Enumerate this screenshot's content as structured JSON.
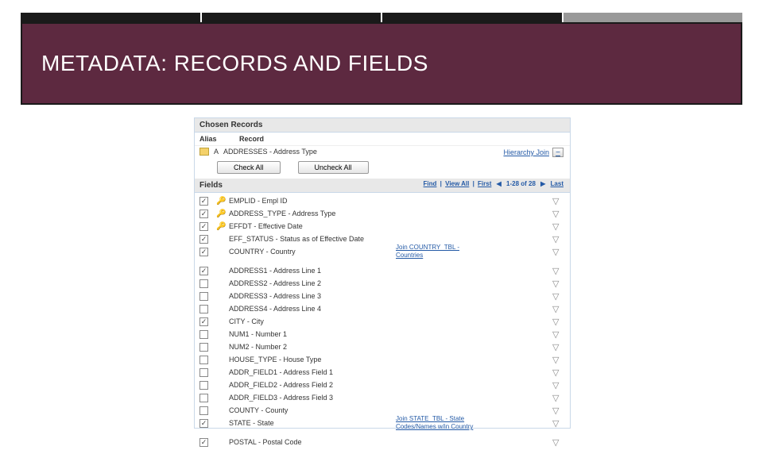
{
  "slide_title": "METADATA: RECORDS AND FIELDS",
  "panel": {
    "chosen_records": "Chosen Records",
    "alias_hdr": "Alias",
    "record_hdr": "Record",
    "alias_value": "A",
    "record_value": "ADDRESSES - Address Type",
    "check_all": "Check All",
    "uncheck_all": "Uncheck All",
    "hierarchy_join": "Hierarchy Join",
    "fields_hdr": "Fields",
    "pager": {
      "find": "Find",
      "viewall": "View All",
      "first": "First",
      "range": "1-28 of 28",
      "last": "Last"
    }
  },
  "fields": [
    {
      "checked": true,
      "key": true,
      "label": "EMPLID - Empl ID",
      "join": ""
    },
    {
      "checked": true,
      "key": true,
      "label": "ADDRESS_TYPE - Address Type",
      "join": ""
    },
    {
      "checked": true,
      "key": true,
      "label": "EFFDT - Effective Date",
      "join": ""
    },
    {
      "checked": true,
      "key": false,
      "label": "EFF_STATUS - Status as of Effective Date",
      "join": ""
    },
    {
      "checked": true,
      "key": false,
      "label": "COUNTRY - Country",
      "join": "Join COUNTRY_TBL - Countries"
    },
    {
      "checked": true,
      "key": false,
      "label": "ADDRESS1 - Address Line 1",
      "join": ""
    },
    {
      "checked": false,
      "key": false,
      "label": "ADDRESS2 - Address Line 2",
      "join": ""
    },
    {
      "checked": false,
      "key": false,
      "label": "ADDRESS3 - Address Line 3",
      "join": ""
    },
    {
      "checked": false,
      "key": false,
      "label": "ADDRESS4 - Address Line 4",
      "join": ""
    },
    {
      "checked": true,
      "key": false,
      "label": "CITY - City",
      "join": ""
    },
    {
      "checked": false,
      "key": false,
      "label": "NUM1 - Number 1",
      "join": ""
    },
    {
      "checked": false,
      "key": false,
      "label": "NUM2 - Number 2",
      "join": ""
    },
    {
      "checked": false,
      "key": false,
      "label": "HOUSE_TYPE - House Type",
      "join": ""
    },
    {
      "checked": false,
      "key": false,
      "label": "ADDR_FIELD1 - Address Field 1",
      "join": ""
    },
    {
      "checked": false,
      "key": false,
      "label": "ADDR_FIELD2 - Address Field 2",
      "join": ""
    },
    {
      "checked": false,
      "key": false,
      "label": "ADDR_FIELD3 - Address Field 3",
      "join": ""
    },
    {
      "checked": false,
      "key": false,
      "label": "COUNTY - County",
      "join": ""
    },
    {
      "checked": true,
      "key": false,
      "label": "STATE - State",
      "join": "Join STATE_TBL - State Codes/Names w/in Country"
    },
    {
      "checked": true,
      "key": false,
      "label": "POSTAL - Postal Code",
      "join": ""
    }
  ]
}
